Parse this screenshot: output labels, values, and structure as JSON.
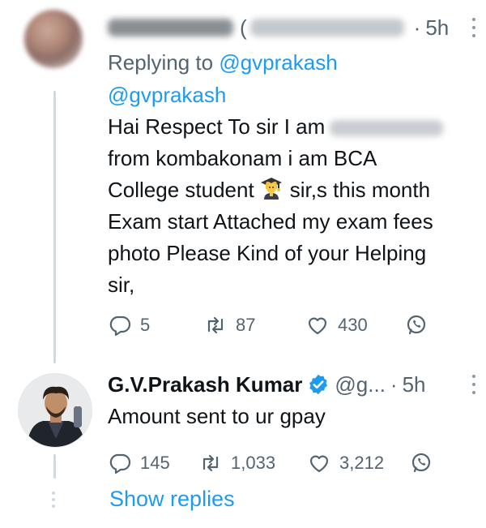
{
  "tweet1": {
    "time": "5h",
    "replying_label": "Replying to ",
    "replying_handle": "@gvprakash",
    "mention": "@gvprakash",
    "line1": "Hai Respect To sir I am",
    "line2": "from kombakonam i am BCA",
    "line3a": "College student",
    "line3b": "sir,s this month",
    "line4": "Exam start Attached my exam fees",
    "line5": "photo Please Kind of your Helping",
    "line6": "sir,",
    "replies": "5",
    "retweets": "87",
    "likes": "430"
  },
  "tweet2": {
    "display_name": "G.V.Prakash Kumar",
    "handle": "@g...",
    "time": "5h",
    "text": "Amount sent to ur gpay",
    "replies": "145",
    "retweets": "1,033",
    "likes": "3,212"
  },
  "show_replies": "Show replies",
  "icons": [
    "reply-icon",
    "retweet-icon",
    "like-icon",
    "share-icon",
    "verified-badge-icon",
    "more-icon",
    "student-emoji-icon"
  ],
  "colors": {
    "accent": "#1d9bf0",
    "muted": "#536471",
    "text": "#0f1419",
    "line": "#cfd9de"
  }
}
